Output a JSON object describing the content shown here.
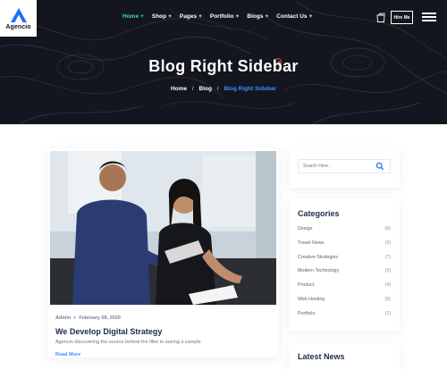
{
  "brand": {
    "name": "Agencio"
  },
  "nav": {
    "items": [
      {
        "label": "Home",
        "active": true
      },
      {
        "label": "Shop",
        "active": false
      },
      {
        "label": "Pages",
        "active": false
      },
      {
        "label": "Portfolio",
        "active": false
      },
      {
        "label": "Blogs",
        "active": false
      },
      {
        "label": "Contact Us",
        "active": false
      }
    ],
    "plus": "+",
    "hire_label": "Hire Me"
  },
  "hero": {
    "title": "Blog Right Sidebar",
    "breadcrumb": [
      "Home",
      "Blog",
      "Blog Right Sidebar"
    ],
    "separator": "/"
  },
  "post": {
    "author": "Admin",
    "date": "February 08, 2020",
    "title": "We Develop Digital Strategy",
    "excerpt": "Agencio discovering the source behind the filler in seeing a sample",
    "read_more": "Read More"
  },
  "sidebar": {
    "search_placeholder": "Search Here..",
    "categories_heading": "Categories",
    "categories": [
      {
        "label": "Design",
        "count": "(8)"
      },
      {
        "label": "Travel News",
        "count": "(3)"
      },
      {
        "label": "Creative Strategies",
        "count": "(7)"
      },
      {
        "label": "Modern Technology",
        "count": "(3)"
      },
      {
        "label": "Product",
        "count": "(4)"
      },
      {
        "label": "Web Hosting",
        "count": "(5)"
      },
      {
        "label": "Portfolio",
        "count": "(1)"
      }
    ],
    "latest_heading": "Latest News"
  },
  "colors": {
    "hero_bg": "#14161f",
    "accent_green": "#3dd9a8",
    "accent_blue": "#3c8dff",
    "heading_navy": "#1b2b4b"
  }
}
